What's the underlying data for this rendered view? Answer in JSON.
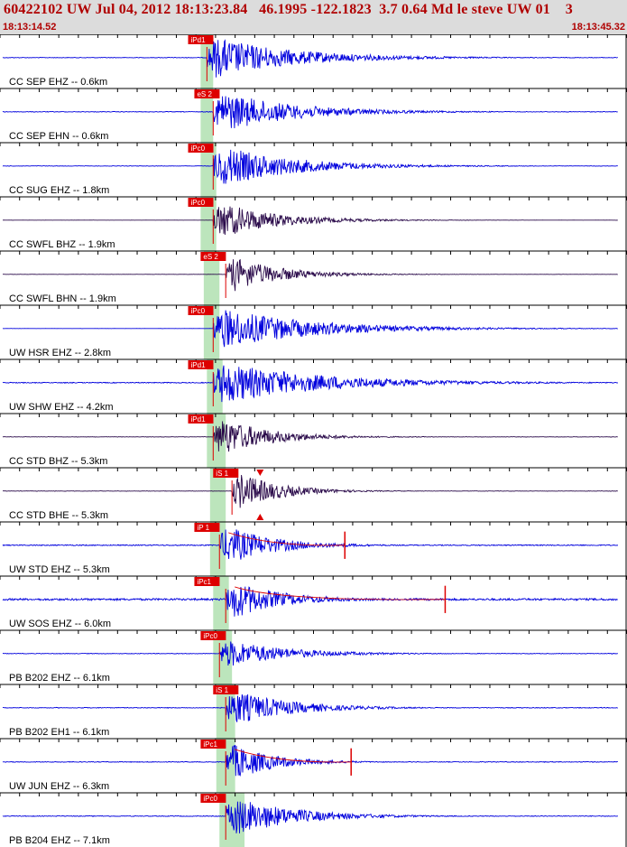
{
  "header": {
    "title": "60422102 UW Jul 04, 2012 18:13:23.84   46.1995 -122.1823  3.7 0.64 Md le steve UW 01    3",
    "start_time": "18:13:14.52",
    "end_time": "18:13:45.32"
  },
  "colors": {
    "header_bg": "#dcdcdc",
    "header_text": "#b00000",
    "trace_blue": "#0000dd",
    "trace_dark": "#2a0a4a",
    "pick_red": "#dd0000",
    "window_green": "#a6dca6"
  },
  "traces": [
    {
      "label": "CC SEP EHZ -- 0.6km",
      "pick": "iPd1",
      "color": "blue",
      "onset": 0.33,
      "amp": 1.0,
      "decay": 0.2,
      "noise": 0.1,
      "pick_x": 0.3,
      "green": [
        0.32,
        0.34
      ]
    },
    {
      "label": "CC SEP EHN -- 0.6km",
      "pick": "eS 2",
      "color": "blue",
      "onset": 0.34,
      "amp": 1.0,
      "decay": 0.18,
      "noise": 0.1,
      "pick_x": 0.31,
      "green": [
        0.32,
        0.34
      ]
    },
    {
      "label": "CC SUG EHZ -- 1.8km",
      "pick": "iPc0",
      "color": "blue",
      "onset": 0.34,
      "amp": 1.0,
      "decay": 0.18,
      "noise": 0.08,
      "pick_x": 0.3,
      "green": [
        0.32,
        0.345
      ]
    },
    {
      "label": "CC SWFL BHZ -- 1.9km",
      "pick": "iPc0",
      "color": "dark",
      "onset": 0.34,
      "amp": 0.9,
      "decay": 0.14,
      "noise": 0.02,
      "pick_x": 0.3,
      "green": [
        0.32,
        0.345
      ]
    },
    {
      "label": "CC SWFL BHN -- 1.9km",
      "pick": "eS 2",
      "color": "dark",
      "onset": 0.36,
      "amp": 0.9,
      "decay": 0.12,
      "noise": 0.03,
      "pick_x": 0.32,
      "green": [
        0.325,
        0.35
      ]
    },
    {
      "label": "UW HSR EHZ -- 2.8km",
      "pick": "iPc0",
      "color": "blue",
      "onset": 0.34,
      "amp": 1.0,
      "decay": 0.22,
      "noise": 0.02,
      "pick_x": 0.3,
      "green": [
        0.325,
        0.35
      ]
    },
    {
      "label": "UW SHW EHZ -- 4.2km",
      "pick": "iPd1",
      "color": "blue",
      "onset": 0.34,
      "amp": 1.0,
      "decay": 0.25,
      "noise": 0.15,
      "pick_x": 0.3,
      "green": [
        0.33,
        0.355
      ]
    },
    {
      "label": "CC STD BHZ -- 5.3km",
      "pick": "iPd1",
      "color": "dark",
      "onset": 0.34,
      "amp": 1.0,
      "decay": 0.12,
      "noise": 0.06,
      "pick_x": 0.3,
      "green": [
        0.33,
        0.36
      ]
    },
    {
      "label": "CC STD BHE -- 5.3km",
      "pick": "iS 1",
      "color": "dark",
      "onset": 0.37,
      "amp": 1.0,
      "decay": 0.1,
      "noise": 0.06,
      "pick_x": 0.34,
      "green": [
        0.335,
        0.36
      ]
    },
    {
      "label": "UW STD EHZ -- 5.3km",
      "pick": "iP 1",
      "color": "blue",
      "onset": 0.35,
      "amp": 1.0,
      "decay": 0.12,
      "noise": 0.18,
      "pick_x": 0.31,
      "green": [
        0.335,
        0.36
      ],
      "tail_spike": 0.55
    },
    {
      "label": "UW SOS EHZ -- 6.0km",
      "pick": "iPc1",
      "color": "blue",
      "onset": 0.36,
      "amp": 1.0,
      "decay": 0.12,
      "noise": 0.35,
      "pick_x": 0.31,
      "green": [
        0.34,
        0.365
      ],
      "tail_spike": 0.71
    },
    {
      "label": "PB B202 EHZ -- 6.1km",
      "pick": "iPc0",
      "color": "blue",
      "onset": 0.35,
      "amp": 0.7,
      "decay": 0.15,
      "noise": 0.1,
      "pick_x": 0.32,
      "green": [
        0.34,
        0.37
      ]
    },
    {
      "label": "PB B202 EH1 -- 6.1km",
      "pick": "iS 1",
      "color": "blue",
      "onset": 0.36,
      "amp": 0.9,
      "decay": 0.14,
      "noise": 0.12,
      "pick_x": 0.34,
      "green": [
        0.345,
        0.375
      ]
    },
    {
      "label": "UW JUN EHZ -- 6.3km",
      "pick": "iPc1",
      "color": "blue",
      "onset": 0.36,
      "amp": 1.0,
      "decay": 0.1,
      "noise": 0.12,
      "pick_x": 0.32,
      "green": [
        0.345,
        0.375
      ],
      "tail_spike": 0.56
    },
    {
      "label": "PB B204 EHZ -- 7.1km",
      "pick": "iPc0",
      "color": "blue",
      "onset": 0.36,
      "amp": 1.0,
      "decay": 0.15,
      "noise": 0.12,
      "pick_x": 0.32,
      "green": [
        0.35,
        0.39
      ]
    }
  ]
}
